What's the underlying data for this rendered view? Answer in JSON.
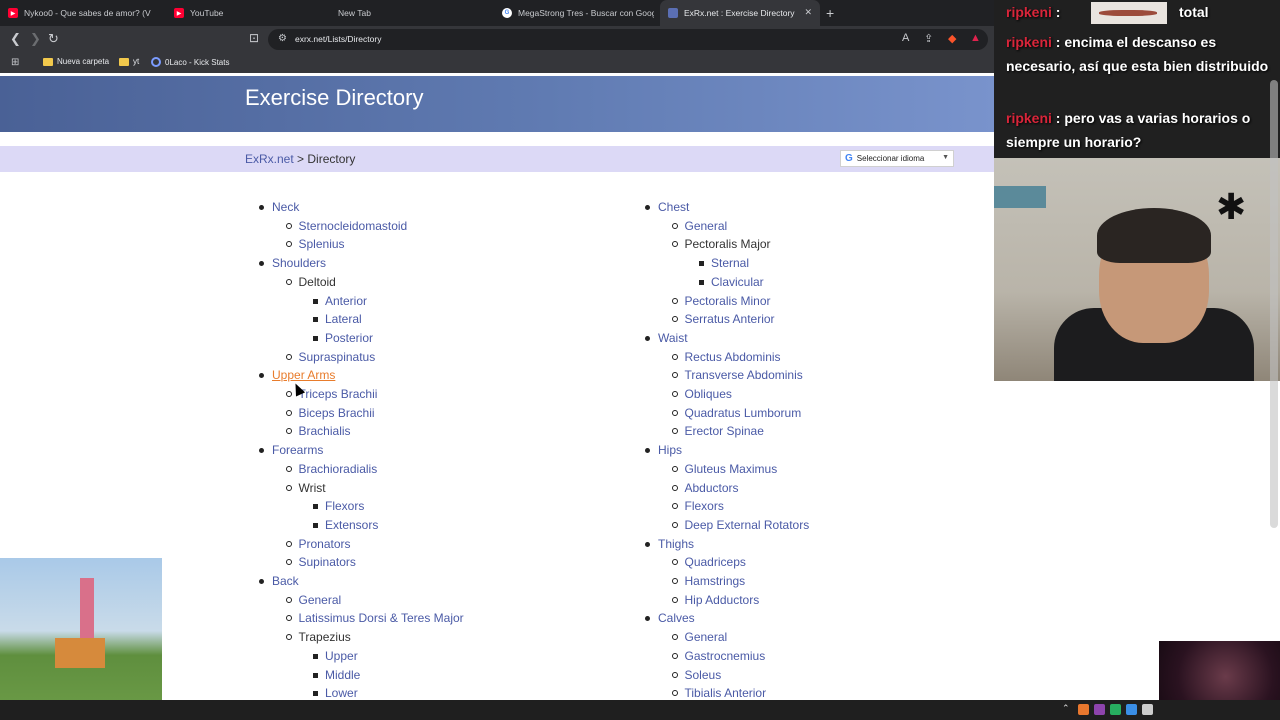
{
  "browser": {
    "tabs": [
      {
        "label": "Nykoo0 - Que sabes de amor? (V",
        "favicon_color": "#ff0033"
      },
      {
        "label": "YouTube",
        "favicon_color": "#ff0033"
      },
      {
        "label": "New Tab",
        "favicon_color": ""
      },
      {
        "label": "MegaStrong Tres - Buscar con Googl",
        "favicon_color": "#4285f4"
      },
      {
        "label": "ExRx.net : Exercise Directory",
        "favicon_color": "#5b6fb3"
      }
    ],
    "url": "exrx.net/Lists/Directory",
    "bookmarks": [
      {
        "label": "Nueva carpeta"
      },
      {
        "label": "yt"
      },
      {
        "label": "0Laco - Kick Stats"
      }
    ]
  },
  "page": {
    "title": "Exercise Directory",
    "breadcrumb_link": "ExRx.net",
    "breadcrumb_sep": " > ",
    "breadcrumb_current": "Directory",
    "language_label": "Seleccionar idioma",
    "left_items": [
      {
        "text": "Neck",
        "level": 1,
        "link": true
      },
      {
        "text": "Sternocleidomastoid",
        "level": 2,
        "link": true
      },
      {
        "text": "Splenius",
        "level": 2,
        "link": true
      },
      {
        "text": "Shoulders",
        "level": 1,
        "link": true
      },
      {
        "text": "Deltoid",
        "level": 2,
        "link": false
      },
      {
        "text": "Anterior",
        "level": 3,
        "link": true
      },
      {
        "text": "Lateral",
        "level": 3,
        "link": true
      },
      {
        "text": "Posterior",
        "level": 3,
        "link": true
      },
      {
        "text": "Supraspinatus",
        "level": 2,
        "link": true
      },
      {
        "text": "Upper Arms",
        "level": 1,
        "link": true,
        "hover": true
      },
      {
        "text": "Triceps Brachii",
        "level": 2,
        "link": true
      },
      {
        "text": "Biceps Brachii",
        "level": 2,
        "link": true
      },
      {
        "text": "Brachialis",
        "level": 2,
        "link": true
      },
      {
        "text": "Forearms",
        "level": 1,
        "link": true
      },
      {
        "text": "Brachioradialis",
        "level": 2,
        "link": true
      },
      {
        "text": "Wrist",
        "level": 2,
        "link": false
      },
      {
        "text": "Flexors",
        "level": 3,
        "link": true
      },
      {
        "text": "Extensors",
        "level": 3,
        "link": true
      },
      {
        "text": "Pronators",
        "level": 2,
        "link": true
      },
      {
        "text": "Supinators",
        "level": 2,
        "link": true
      },
      {
        "text": "Back",
        "level": 1,
        "link": true
      },
      {
        "text": "General",
        "level": 2,
        "link": true
      },
      {
        "text": "Latissimus Dorsi & Teres Major",
        "level": 2,
        "link": true
      },
      {
        "text": "Trapezius",
        "level": 2,
        "link": false
      },
      {
        "text": "Upper",
        "level": 3,
        "link": true
      },
      {
        "text": "Middle",
        "level": 3,
        "link": true
      },
      {
        "text": "Lower",
        "level": 3,
        "link": true
      }
    ],
    "right_items": [
      {
        "text": "Chest",
        "level": 1,
        "link": true
      },
      {
        "text": "General",
        "level": 2,
        "link": true
      },
      {
        "text": "Pectoralis Major",
        "level": 2,
        "link": false
      },
      {
        "text": "Sternal",
        "level": 3,
        "link": true
      },
      {
        "text": "Clavicular",
        "level": 3,
        "link": true
      },
      {
        "text": "Pectoralis Minor",
        "level": 2,
        "link": true
      },
      {
        "text": "Serratus Anterior",
        "level": 2,
        "link": true
      },
      {
        "text": "Waist",
        "level": 1,
        "link": true
      },
      {
        "text": "Rectus Abdominis",
        "level": 2,
        "link": true
      },
      {
        "text": "Transverse Abdominis",
        "level": 2,
        "link": true
      },
      {
        "text": "Obliques",
        "level": 2,
        "link": true
      },
      {
        "text": "Quadratus Lumborum",
        "level": 2,
        "link": true
      },
      {
        "text": "Erector Spinae",
        "level": 2,
        "link": true
      },
      {
        "text": "Hips",
        "level": 1,
        "link": true
      },
      {
        "text": "Gluteus Maximus",
        "level": 2,
        "link": true
      },
      {
        "text": "Abductors",
        "level": 2,
        "link": true
      },
      {
        "text": "Flexors",
        "level": 2,
        "link": true
      },
      {
        "text": "Deep External Rotators",
        "level": 2,
        "link": true
      },
      {
        "text": "Thighs",
        "level": 1,
        "link": true
      },
      {
        "text": "Quadriceps",
        "level": 2,
        "link": true
      },
      {
        "text": "Hamstrings",
        "level": 2,
        "link": true
      },
      {
        "text": "Hip Adductors",
        "level": 2,
        "link": true
      },
      {
        "text": "Calves",
        "level": 1,
        "link": true
      },
      {
        "text": "General",
        "level": 2,
        "link": true
      },
      {
        "text": "Gastrocnemius",
        "level": 2,
        "link": true
      },
      {
        "text": "Soleus",
        "level": 2,
        "link": true
      },
      {
        "text": "Tibialis Anterior",
        "level": 2,
        "link": true
      }
    ]
  },
  "chat": {
    "lines": [
      {
        "user": "ripkeni",
        "message": "total"
      },
      {
        "user": "ripkeni",
        "message": "encima el descanso es necesario, así que esta bien distribuido"
      },
      {
        "user": "ripkeni",
        "message": "pero vas a varias horarios o siempre un horario?"
      }
    ]
  },
  "colors": {
    "link": "#4a5aa6",
    "hover_link": "#e87c2c",
    "banner": "#607bb2",
    "breadcrumb_bg": "#dcd9f6",
    "chat_user": "#d9253a"
  }
}
